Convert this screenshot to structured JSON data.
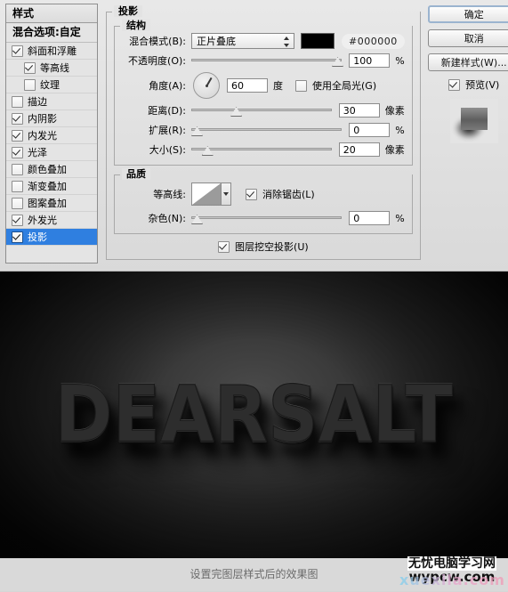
{
  "dialog": {
    "styles_panel": {
      "header": "样式",
      "blending_options": "混合选项:自定",
      "effects": [
        {
          "label": "斜面和浮雕",
          "checked": true,
          "indent": false,
          "selected": false
        },
        {
          "label": "等高线",
          "checked": true,
          "indent": true,
          "selected": false
        },
        {
          "label": "纹理",
          "checked": false,
          "indent": true,
          "selected": false
        },
        {
          "label": "描边",
          "checked": false,
          "indent": false,
          "selected": false
        },
        {
          "label": "内阴影",
          "checked": true,
          "indent": false,
          "selected": false
        },
        {
          "label": "内发光",
          "checked": true,
          "indent": false,
          "selected": false
        },
        {
          "label": "光泽",
          "checked": true,
          "indent": false,
          "selected": false
        },
        {
          "label": "颜色叠加",
          "checked": false,
          "indent": false,
          "selected": false
        },
        {
          "label": "渐变叠加",
          "checked": false,
          "indent": false,
          "selected": false
        },
        {
          "label": "图案叠加",
          "checked": false,
          "indent": false,
          "selected": false
        },
        {
          "label": "外发光",
          "checked": true,
          "indent": false,
          "selected": false
        },
        {
          "label": "投影",
          "checked": true,
          "indent": false,
          "selected": true
        }
      ]
    },
    "settings": {
      "panel_title": "投影",
      "structure": {
        "legend": "结构",
        "blend_mode": {
          "label": "混合模式(B):",
          "value": "正片叠底",
          "color_hex": "#000000",
          "hex_label": "#000000"
        },
        "opacity": {
          "label": "不透明度(O):",
          "value": "100",
          "unit": "%",
          "percent": 100
        },
        "angle": {
          "label": "角度(A):",
          "value": "60",
          "unit": "度",
          "degrees": 60,
          "global_light_label": "使用全局光(G)",
          "global_light_checked": false
        },
        "distance": {
          "label": "距离(D):",
          "value": "30",
          "unit": "像素",
          "percent": 30
        },
        "spread": {
          "label": "扩展(R):",
          "value": "0",
          "unit": "%",
          "percent": 0
        },
        "size": {
          "label": "大小(S):",
          "value": "20",
          "unit": "像素",
          "percent": 8
        }
      },
      "quality": {
        "legend": "品质",
        "contour": {
          "label": "等高线:",
          "antialias_label": "消除锯齿(L)",
          "antialias_checked": true
        },
        "noise": {
          "label": "杂色(N):",
          "value": "0",
          "unit": "%",
          "percent": 0
        }
      },
      "knockout": {
        "label": "图层挖空投影(U)",
        "checked": true
      }
    },
    "buttons": {
      "ok": "确定",
      "cancel": "取消",
      "new_style": "新建样式(W)...",
      "preview_label": "预览(V)",
      "preview_checked": true
    }
  },
  "photo": {
    "text": "DEARSALT"
  },
  "caption": {
    "text": "设置完图层样式后的效果图",
    "watermark_cn": "无忧电脑学习网",
    "watermark_en": "wypcw.com",
    "watermark_ghost": "xuexila.com"
  },
  "colors": {
    "selection_blue": "#2f7fe0",
    "dialog_bg": "#e3e3e3",
    "photo_bg": "#262626"
  }
}
